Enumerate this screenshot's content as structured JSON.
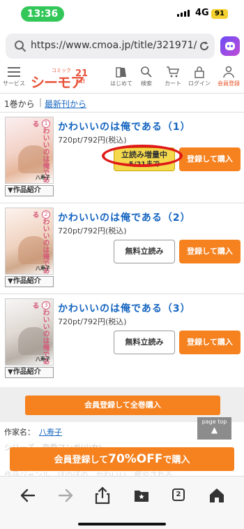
{
  "status_bar": {
    "time": "13:36",
    "network": "4G",
    "battery": "91"
  },
  "url_bar": {
    "url": "https://www.cmoa.jp/title/321971/"
  },
  "site_header": {
    "menu_label": "サービス",
    "logo_small": "コミック",
    "logo_main": "シーモア",
    "logo_num": "21",
    "logo_st": "st!",
    "nav": [
      {
        "label": "はじめて",
        "icon": "book-icon"
      },
      {
        "label": "検索",
        "icon": "search-icon"
      },
      {
        "label": "カート",
        "icon": "cart-icon"
      },
      {
        "label": "ログイン",
        "icon": "lock-icon"
      },
      {
        "label": "会員登録",
        "icon": "user-icon"
      }
    ]
  },
  "sort": {
    "from_first": "1巻から",
    "separator": "|",
    "newest": "最新刊から"
  },
  "items": [
    {
      "title": "かわいいのは俺である（1）",
      "price": "720pt/792円(税込)",
      "cover_text": "かわいいのは俺である",
      "cover_vol": "1",
      "cover_author": "八寿子",
      "preview_label": "立読み増量中",
      "preview_sub": "5/21まで",
      "register_label": "登録して購入",
      "intro_label": "▼作品紹介"
    },
    {
      "title": "かわいいのは俺である（2）",
      "price": "720pt/792円(税込)",
      "cover_text": "かわいいのは俺である",
      "cover_vol": "2",
      "cover_author": "八寿子",
      "free_label": "無料立読み",
      "register_label": "登録して購入",
      "intro_label": "▼作品紹介"
    },
    {
      "title": "かわいいのは俺である（3）",
      "price": "720pt/792円(税込)",
      "cover_text": "かわいいのは俺である",
      "cover_vol": "3",
      "cover_author": "八寿子",
      "free_label": "無料立読み",
      "register_label": "登録して購入",
      "intro_label": "▼作品紹介"
    }
  ],
  "bulk": {
    "label": "会員登録して全巻購入"
  },
  "author": {
    "label": "作家名：",
    "name": "八寿子"
  },
  "page_top": {
    "label": "page top",
    "arrow": "▲"
  },
  "faint": {
    "line1": "シリーズ　恋愛マンガ(少女)",
    "line2": "作品ジャンル　ほのぼの　かわいい　癒やされる"
  },
  "sticky": {
    "pre": "会員登録して",
    "big": "70%OFF",
    "post": "で購入"
  },
  "toolbar": {
    "tab_count": "2"
  },
  "colors": {
    "accent_orange": "#f5811f",
    "link_blue": "#1565c0",
    "preview_yellow": "#f5d94c",
    "highlight_red": "#e01919"
  }
}
